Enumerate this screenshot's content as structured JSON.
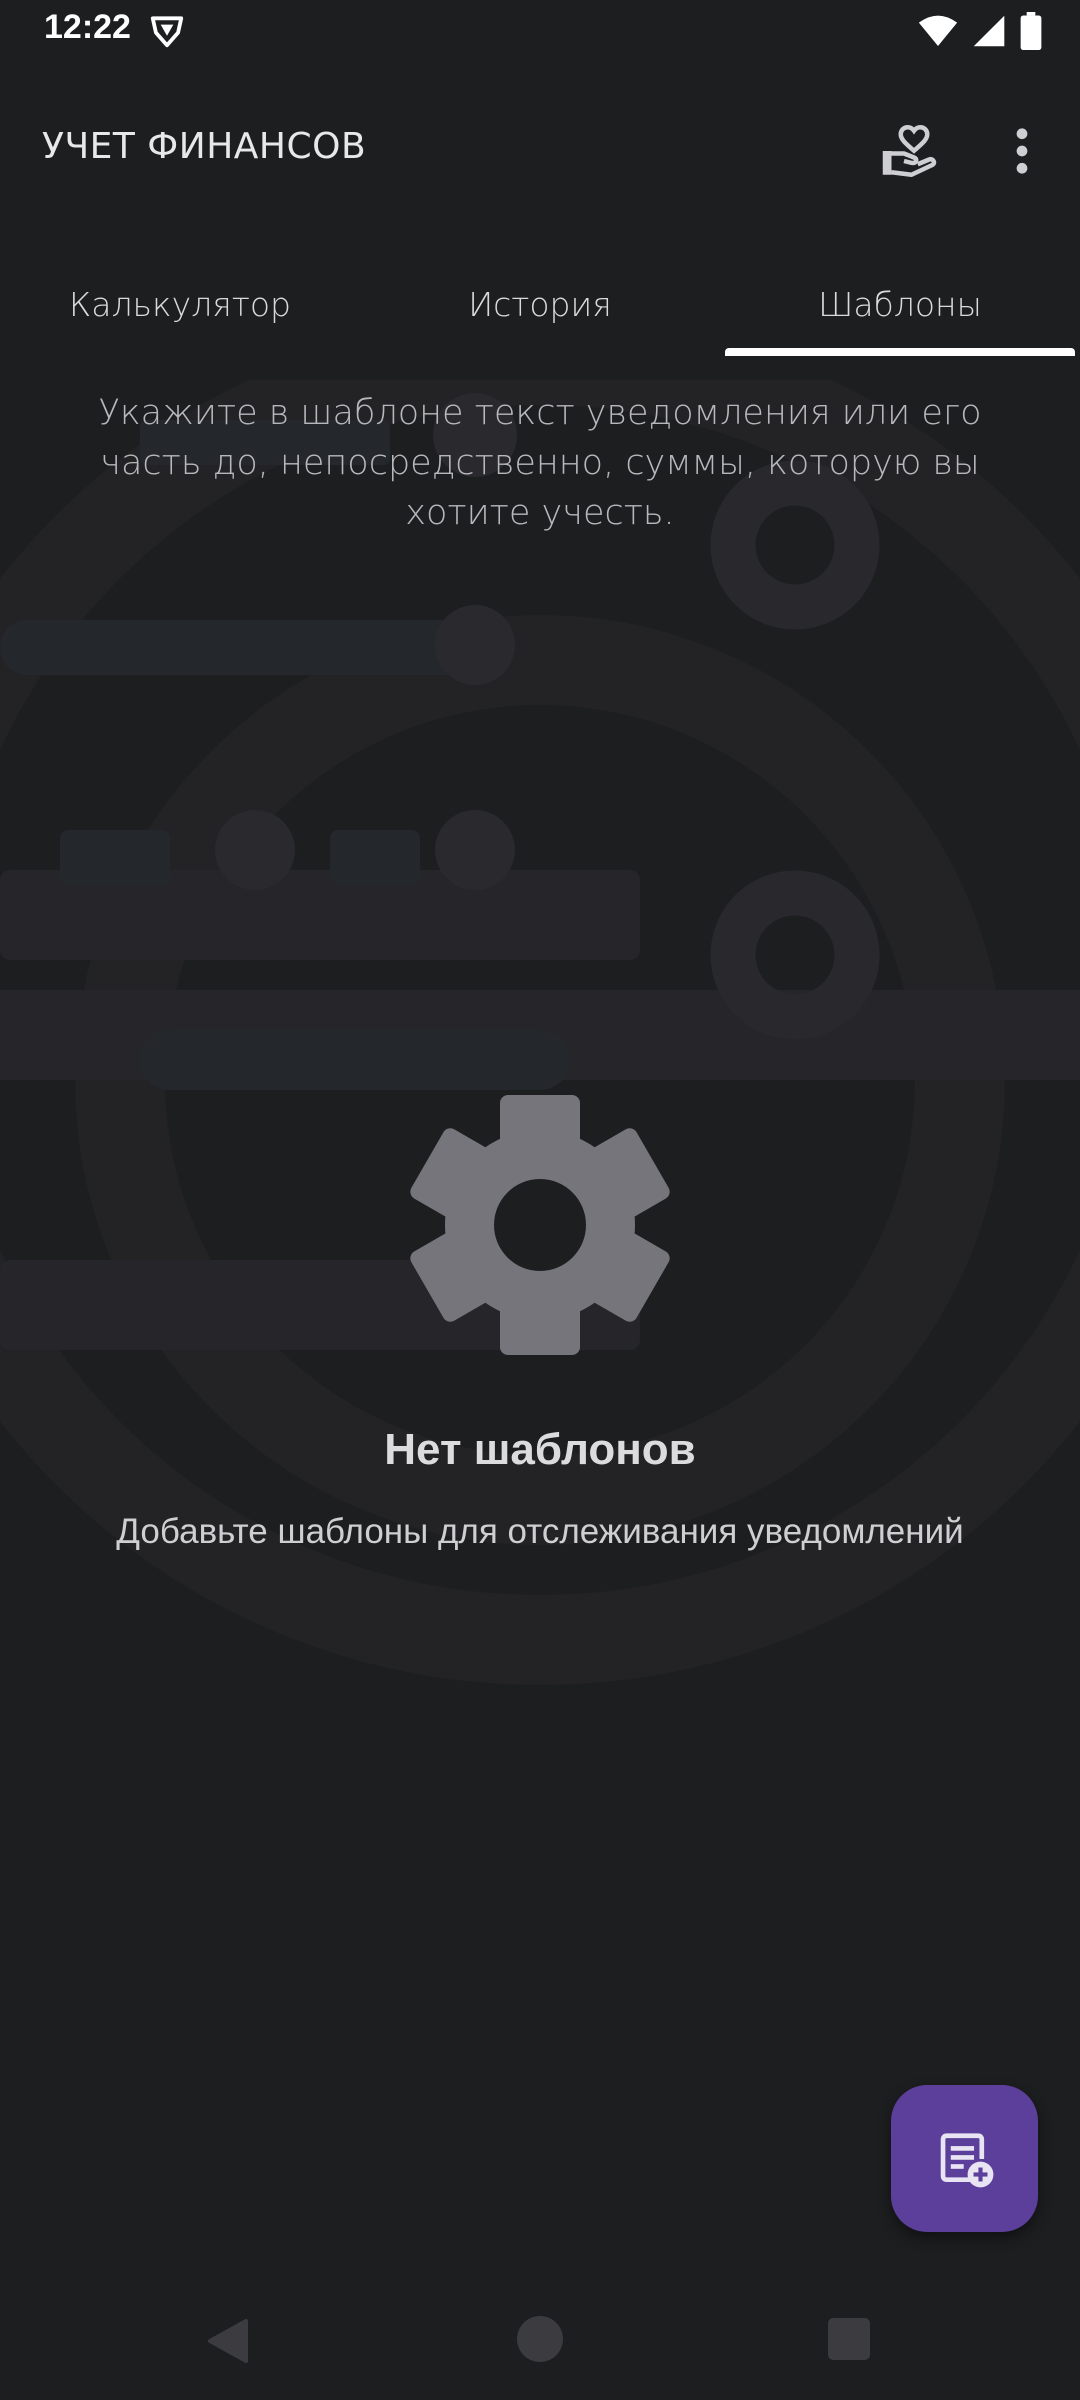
{
  "status_bar": {
    "time": "12:22",
    "left_icon": "vpn-shield-icon",
    "right_icons": [
      "wifi-icon",
      "signal-icon",
      "battery-icon"
    ]
  },
  "app_bar": {
    "title": "УЧЕТ ФИНАНСОВ",
    "icons": [
      "donate-hand-heart-icon",
      "more-vert-icon"
    ]
  },
  "tabs": [
    {
      "label": "Калькулятор",
      "selected": false
    },
    {
      "label": "История",
      "selected": false
    },
    {
      "label": "Шаблоны",
      "selected": true
    }
  ],
  "hint": {
    "text": "Укажите в шаблоне текст уведомления или его часть до, непосредственно, суммы, которую вы хотите учесть."
  },
  "empty_state": {
    "icon": "gear-icon",
    "title": "Нет шаблонов",
    "description": "Добавьте шаблоны для отслеживания уведомлений"
  },
  "fab": {
    "icon": "add-template-icon"
  },
  "nav_bar": {
    "icons": [
      "back-icon",
      "home-icon",
      "recents-icon"
    ]
  },
  "colors": {
    "background": "#1d1e20",
    "accent": "#5b3f9a",
    "tab_indicator": "#ffffff",
    "gear": "#76757b"
  }
}
